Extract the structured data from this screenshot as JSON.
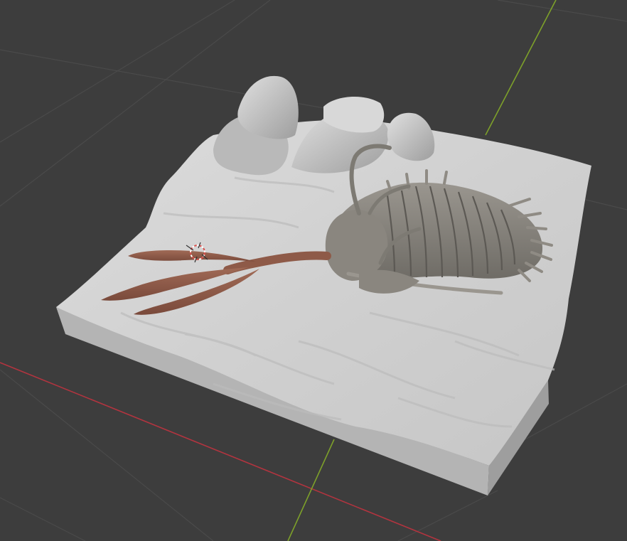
{
  "viewport": {
    "background": "#3d3d3d",
    "grid_color": "#4a4a4a",
    "axis_x_color": "#b2343f",
    "axis_y_color": "#7da02a"
  },
  "scene": {
    "base_color": "#d2d2d2",
    "base_side_color": "#a8a8a8",
    "rock_color": "#c8c8c8",
    "trilobite_color": "#8e8b84",
    "fossil_branch_color": "#8e5a48",
    "icons": [
      "3d-cursor-icon"
    ]
  }
}
